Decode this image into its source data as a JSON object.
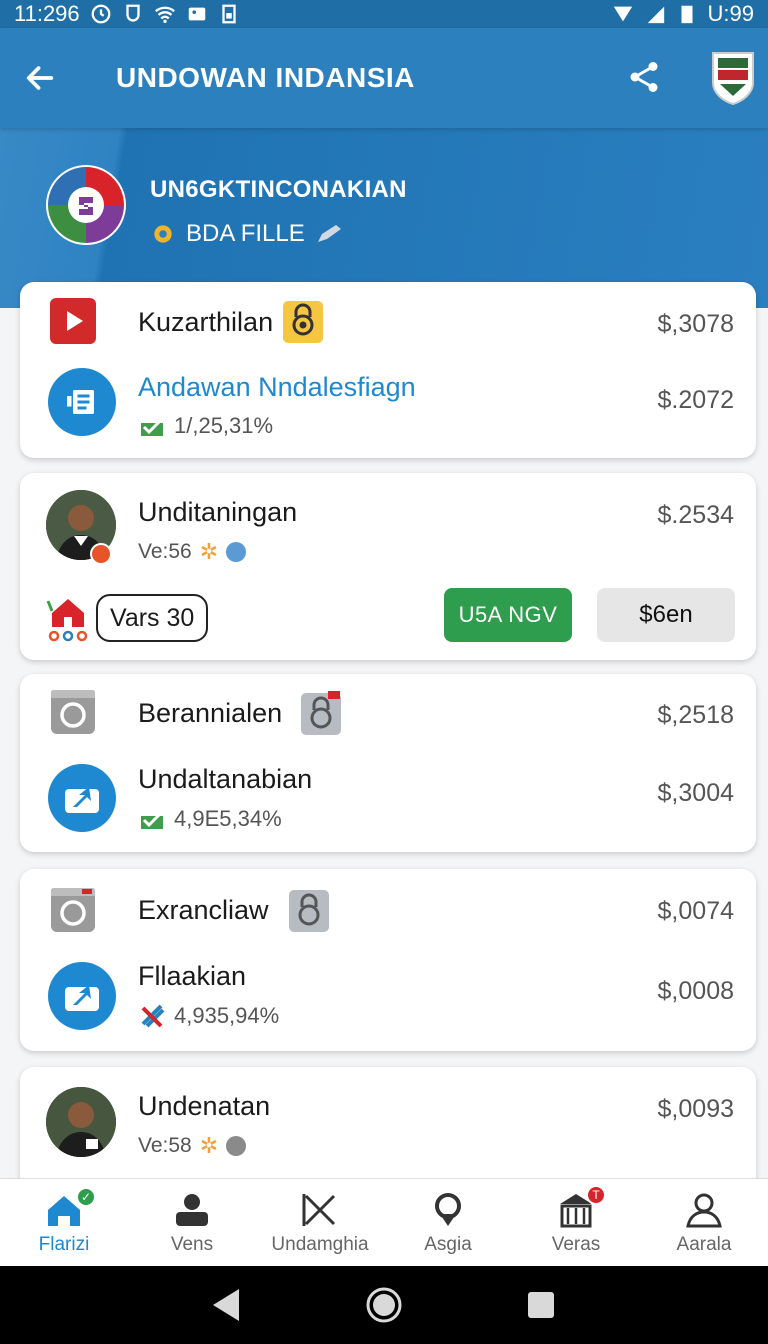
{
  "status_bar": {
    "time": "11:296",
    "battery_text": "U:99"
  },
  "app_bar": {
    "title": "UNDOWAN INDANSIA"
  },
  "header": {
    "title": "UN6GKTINCONAKIAN",
    "subtitle": "BDA FILLE"
  },
  "cards": [
    {
      "rows": [
        {
          "title": "Kuzarthilan",
          "price": "$,3078"
        },
        {
          "title": "Andawan Nndalesfiagn",
          "price": "$.2072",
          "meta": "1/,25,31%"
        }
      ]
    },
    {
      "title": "Unditaningan",
      "price": "$.2534",
      "meta": "Ve:56",
      "pill": "Vars 30",
      "primary_button": "U5A NGV",
      "secondary_button": "$6en"
    },
    {
      "rows": [
        {
          "title": "Berannialen",
          "price": "$,2518"
        },
        {
          "title": "Undaltanabian",
          "price": "$,3004",
          "meta": "4,9E5,34%"
        }
      ]
    },
    {
      "rows": [
        {
          "title": "Exrancliaw",
          "price": "$,0074"
        },
        {
          "title": "Fllaakian",
          "price": "$,0008",
          "meta": "4,935,94%"
        }
      ]
    },
    {
      "title": "Undenatan",
      "price": "$,0093",
      "meta": "Ve:58"
    }
  ],
  "bottom_nav": [
    {
      "label": "Flarizi",
      "icon": "home-icon",
      "active": true
    },
    {
      "label": "Vens",
      "icon": "person-icon"
    },
    {
      "label": "Undamghia",
      "icon": "close-x-icon"
    },
    {
      "label": "Asgia",
      "icon": "location-icon"
    },
    {
      "label": "Veras",
      "icon": "store-icon",
      "badge": "T"
    },
    {
      "label": "Aarala",
      "icon": "profile-icon"
    }
  ],
  "colors": {
    "primary": "#2c80bd",
    "accent_green": "#2e9d4d",
    "link_blue": "#1e88d0"
  }
}
